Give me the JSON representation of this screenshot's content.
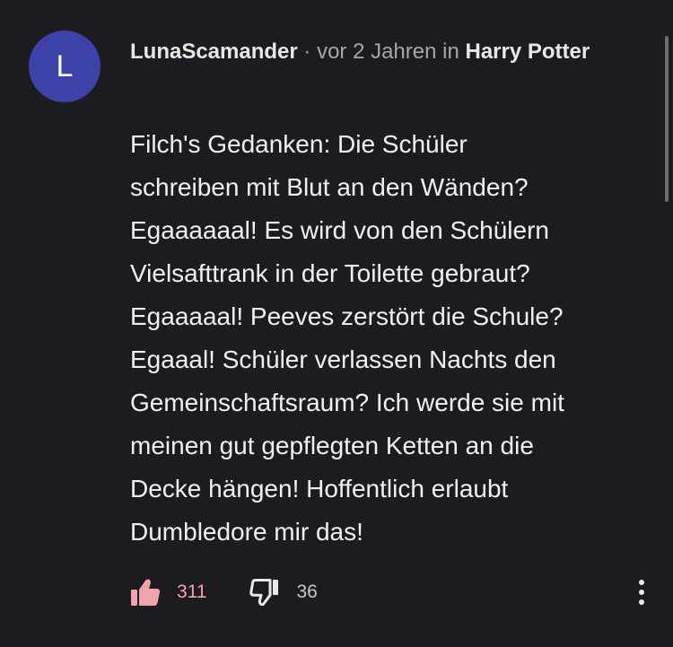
{
  "comment": {
    "avatar_letter": "L",
    "author": "LunaScamander",
    "separator": " · ",
    "time": "vor 2 Jahren",
    "in_label": " in ",
    "channel": "Harry Potter",
    "text": "Filch's Gedanken: Die Schüler\nschreiben mit Blut an den Wänden?\nEgaaaaaal! Es wird von den Schülern\nVielsafttrank in der Toilette gebraut?\nEgaaaaal! Peeves zerstört die Schule?\nEgaaal! Schüler verlassen Nachts den\nGemeinschaftsraum? Ich werde sie mit\nmeinen gut gepflegten Ketten an die\nDecke hängen! Hoffentlich erlaubt\nDumbledore mir das!",
    "likes": "311",
    "dislikes": "36"
  },
  "icons": {
    "like": "thumbs-up-icon",
    "dislike": "thumbs-down-icon",
    "more": "more-vertical-icon"
  },
  "colors": {
    "background": "#1c1b20",
    "avatar": "#3c42a8",
    "like_active": "#f2a2ad",
    "meta": "#a6a6a6"
  }
}
